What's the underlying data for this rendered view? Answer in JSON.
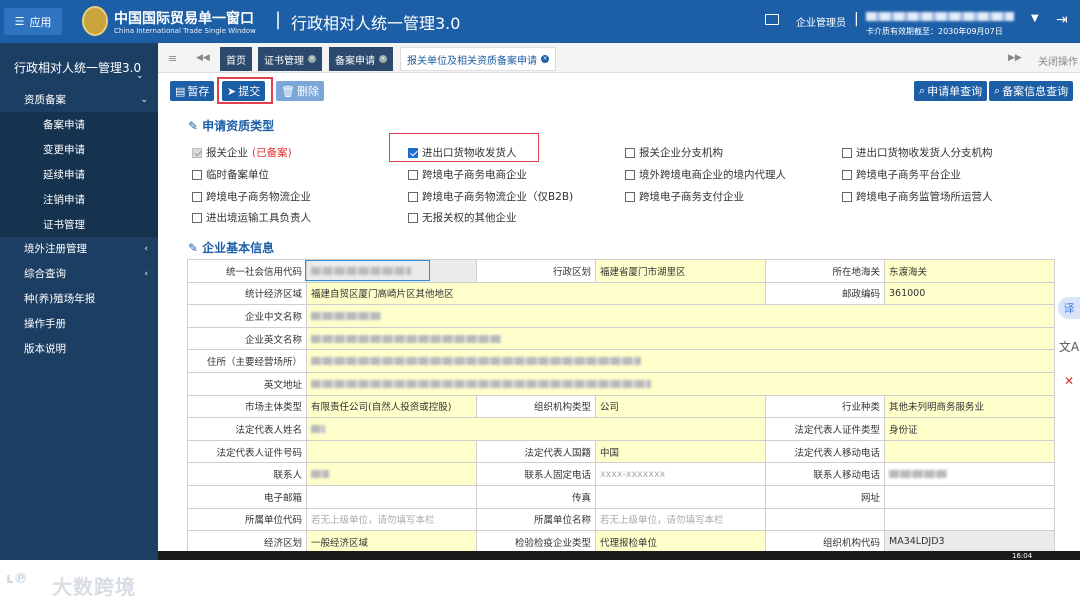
{
  "header": {
    "app_button": "应用",
    "logo_cn": "中国国际贸易单一窗口",
    "logo_en": "China International Trade Single Window",
    "separator": "|",
    "system_title": "行政相对人统一管理3.0",
    "user_label": "企业管理员",
    "user_sep": "|",
    "cert_text": "卡介质有效期截至：2030年09月07日"
  },
  "sidebar": {
    "title": "行政相对人统一管理3.0",
    "items": [
      {
        "label": "资质备案",
        "arrow": "⌄"
      },
      {
        "label": "备案申请"
      },
      {
        "label": "变更申请"
      },
      {
        "label": "延续申请"
      },
      {
        "label": "注销申请"
      },
      {
        "label": "证书管理"
      },
      {
        "label": "境外注册管理",
        "arrow": "‹"
      },
      {
        "label": "综合查询",
        "arrow": "‹"
      },
      {
        "label": "种(养)殖场年报"
      },
      {
        "label": "操作手册"
      },
      {
        "label": "版本说明"
      }
    ]
  },
  "tabs": [
    {
      "label": "首页"
    },
    {
      "label": "证书管理",
      "x": "×"
    },
    {
      "label": "备案申请",
      "x": "×"
    },
    {
      "label": "报关单位及相关资质备案申请",
      "x": "×"
    }
  ],
  "tab_controls": {
    "menu": "≡",
    "prev": "◀◀",
    "next": "▶▶",
    "close_ops": "关闭操作"
  },
  "toolbar": {
    "save": "暂存",
    "submit": "提交",
    "delete": "删除",
    "query_app": "申请单查询",
    "query_record": "备案信息查询"
  },
  "section1": {
    "title": "申请资质类型",
    "options": [
      {
        "label": "报关企业",
        "suffix": "(已备案)",
        "state": "grey"
      },
      {
        "label": "进出口货物收发货人",
        "state": "checked"
      },
      {
        "label": "报关企业分支机构",
        "state": "off"
      },
      {
        "label": "进出口货物收发货人分支机构",
        "state": "off"
      },
      {
        "label": "临时备案单位",
        "state": "off"
      },
      {
        "label": "跨境电子商务电商企业",
        "state": "off"
      },
      {
        "label": "境外跨境电商企业的境内代理人",
        "state": "off"
      },
      {
        "label": "跨境电子商务平台企业",
        "state": "off"
      },
      {
        "label": "跨境电子商务物流企业",
        "state": "off"
      },
      {
        "label": "跨境电子商务物流企业（仅B2B)",
        "state": "off"
      },
      {
        "label": "跨境电子商务支付企业",
        "state": "off"
      },
      {
        "label": "跨境电子商务监管场所运营人",
        "state": "off"
      },
      {
        "label": "进出境运输工具负责人",
        "state": "off"
      },
      {
        "label": "无报关权的其他企业",
        "state": "off"
      }
    ]
  },
  "section2": {
    "title": "企业基本信息",
    "rows": [
      [
        {
          "k": "统一社会信用代码",
          "v": "",
          "style": "grey",
          "blur": 100
        },
        {
          "k": "行政区划",
          "v": "福建省厦门市湖里区"
        },
        {
          "k": "所在地海关",
          "v": "东渡海关"
        }
      ],
      [
        {
          "k": "统计经济区域",
          "v": "福建自贸区厦门高崎片区其他地区",
          "span": 3
        },
        {
          "k": "邮政编码",
          "v": "361000"
        }
      ],
      [
        {
          "k": "企业中文名称",
          "v": "",
          "span": 5,
          "blur": 70
        }
      ],
      [
        {
          "k": "企业英文名称",
          "v": "",
          "span": 5,
          "blur": 190
        }
      ],
      [
        {
          "k": "住所（主要经营场所）",
          "v": "",
          "span": 5,
          "blur": 330
        }
      ],
      [
        {
          "k": "英文地址",
          "v": "",
          "span": 5,
          "blur": 340
        }
      ],
      [
        {
          "k": "市场主体类型",
          "v": "有限责任公司(自然人投资或控股)"
        },
        {
          "k": "组织机构类型",
          "v": "公司"
        },
        {
          "k": "行业种类",
          "v": "其他未列明商务服务业"
        }
      ],
      [
        {
          "k": "法定代表人姓名",
          "v": "",
          "span": 3,
          "blur": 14
        },
        {
          "k": "法定代表人证件类型",
          "v": "身份证"
        }
      ],
      [
        {
          "k": "法定代表人证件号码",
          "v": "",
          "blur": 0
        },
        {
          "k": "法定代表人国籍",
          "v": "中国"
        },
        {
          "k": "法定代表人移动电话",
          "v": "",
          "blur": 0
        }
      ],
      [
        {
          "k": "联系人",
          "v": "",
          "blur": 18
        },
        {
          "k": "联系人固定电话",
          "v": "xxxx-xxxxxxx",
          "style": "blank ph"
        },
        {
          "k": "联系人移动电话",
          "v": "",
          "style": "blank",
          "blur": 58
        }
      ],
      [
        {
          "k": "电子邮箱",
          "v": "",
          "style": "blank"
        },
        {
          "k": "传真",
          "v": "",
          "style": "blank"
        },
        {
          "k": "网址",
          "v": "",
          "style": "blank"
        }
      ],
      [
        {
          "k": "所属单位代码",
          "v": "若无上级单位，请勿填写本栏",
          "style": "blank ph"
        },
        {
          "k": "所属单位名称",
          "v": "若无上级单位，请勿填写本栏",
          "style": "blank ph"
        },
        {
          "k": "",
          "v": "",
          "style": "blank"
        }
      ],
      [
        {
          "k": "经济区划",
          "v": "一般经济区域"
        },
        {
          "k": "检验检疫企业类型",
          "v": "代理报检单位"
        },
        {
          "k": "组织机构代码",
          "v": "MA34LDJD3",
          "style": "grey"
        }
      ]
    ]
  },
  "float": {
    "translate": "译",
    "ai": "文A",
    "x": "✕"
  },
  "watermark": {
    "logo": "ʟ℗",
    "text": "大数跨境"
  },
  "taskbar": {
    "time": "16:04"
  }
}
